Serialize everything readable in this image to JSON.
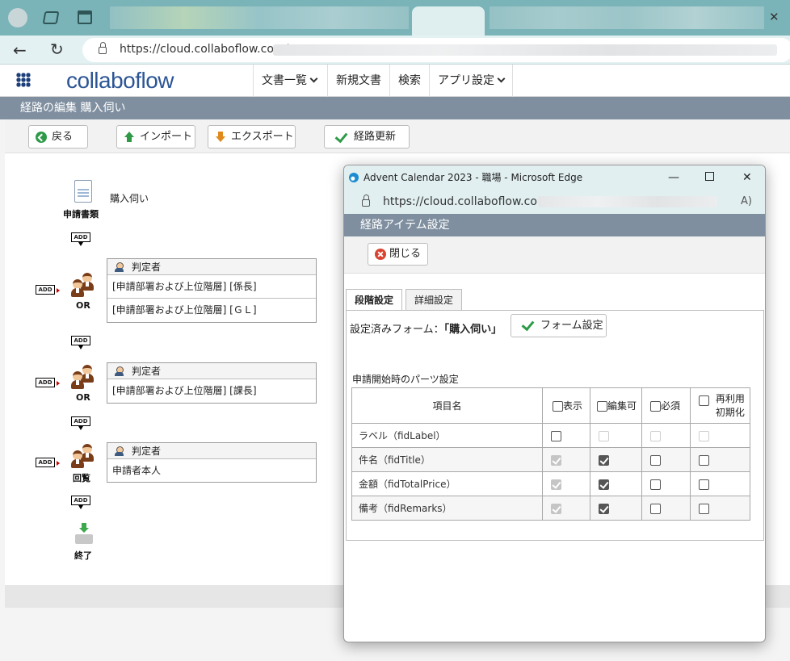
{
  "browser": {
    "url_visible": "https://cloud.collaboflow.com/",
    "back_icon": "arrow-left-icon",
    "reload_icon": "reload-icon"
  },
  "app": {
    "logo": "collaboflow",
    "nav": [
      "文書一覧",
      "新規文書",
      "検索",
      "アプリ設定"
    ],
    "page_title": "経路の編集 購入伺い",
    "buttons": {
      "back": "戻る",
      "import": "インポート",
      "export": "エクスポート",
      "update": "経路更新"
    }
  },
  "route": {
    "form_label": "申請書類",
    "form_name": "購入伺い",
    "add_label": "ADD",
    "steps": [
      {
        "type_label": "OR",
        "header": "判定者",
        "rows": [
          "[申請部署および上位階層] [係長]",
          "[申請部署および上位階層] [ＧＬ]"
        ]
      },
      {
        "type_label": "OR",
        "header": "判定者",
        "rows": [
          "[申請部署および上位階層] [課長]"
        ]
      },
      {
        "type_label": "回覧",
        "header": "判定者",
        "rows": [
          "申請者本人"
        ]
      }
    ],
    "end_label": "終了"
  },
  "popup": {
    "window_title": "Advent Calendar 2023 - 職場 - Microsoft Edge",
    "url": "https://cloud.collaboflow.com/",
    "read_aloud": "A)",
    "header": "経路アイテム設定",
    "close_button": "閉じる",
    "tabs": [
      "段階設定",
      "詳細設定"
    ],
    "form_setting_label": "設定済みフォーム：",
    "form_setting_value": "「購入伺い」",
    "form_setting_button": "フォーム設定",
    "parts_label": "申請開始時のパーツ設定",
    "table": {
      "columns": [
        "項目名",
        "表示",
        "編集可",
        "必須",
        "再利用",
        "初期化"
      ],
      "rows": [
        {
          "name": "ラベル（fidLabel）",
          "show": false,
          "edit": false,
          "req": false,
          "reuse": false,
          "show_dis": false,
          "edit_dis": true,
          "req_dis": true,
          "reuse_dis": true
        },
        {
          "name": "件名（fidTitle）",
          "show": true,
          "edit": true,
          "req": false,
          "reuse": false,
          "show_dis": true,
          "edit_dis": false,
          "req_dis": false,
          "reuse_dis": false
        },
        {
          "name": "金額（fidTotalPrice）",
          "show": true,
          "edit": true,
          "req": false,
          "reuse": false,
          "show_dis": true,
          "edit_dis": false,
          "req_dis": false,
          "reuse_dis": false
        },
        {
          "name": "備考（fidRemarks）",
          "show": true,
          "edit": true,
          "req": false,
          "reuse": false,
          "show_dis": true,
          "edit_dis": false,
          "req_dis": false,
          "reuse_dis": false
        }
      ]
    }
  }
}
